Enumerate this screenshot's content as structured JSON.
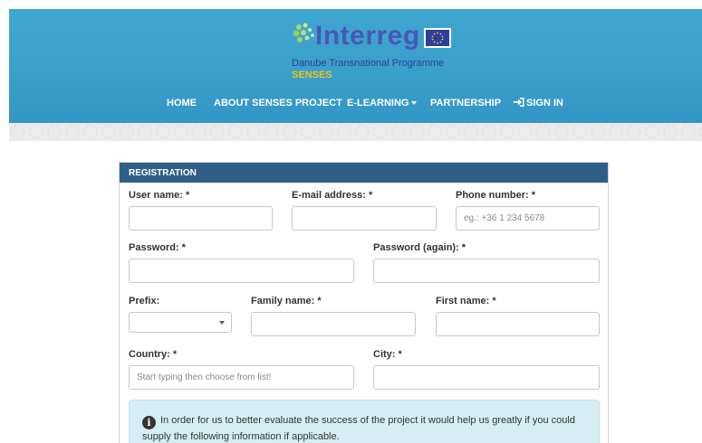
{
  "header": {
    "logo_word": "Interreg",
    "logo_subtitle": "Danube Transnational Programme",
    "logo_project": "SENSES",
    "brand_color": "#3a9fcc"
  },
  "nav": {
    "items": [
      {
        "label": "HOME"
      },
      {
        "label": "ABOUT SENSES PROJECT"
      },
      {
        "label": "E-LEARNING",
        "has_dropdown": true
      },
      {
        "label": "PARTNERSHIP"
      },
      {
        "label": "SIGN IN",
        "icon": "sign-in-icon"
      }
    ]
  },
  "registration": {
    "title": "REGISTRATION",
    "header_color": "#2f5f88",
    "fields": {
      "username": {
        "label": "User name: *",
        "value": ""
      },
      "email": {
        "label": "E-mail address: *",
        "value": ""
      },
      "phone": {
        "label": "Phone number: *",
        "placeholder": "eg.: +36 1 234 5678"
      },
      "password": {
        "label": "Password: *",
        "value": ""
      },
      "password_again": {
        "label": "Password (again): *",
        "value": ""
      },
      "prefix": {
        "label": "Prefix:",
        "selected": ""
      },
      "family_name": {
        "label": "Family name: *",
        "value": ""
      },
      "first_name": {
        "label": "First name: *",
        "value": ""
      },
      "country": {
        "label": "Country: *",
        "placeholder": "Start typing then choose from list!"
      },
      "city": {
        "label": "City: *",
        "value": ""
      }
    },
    "info": {
      "icon": "info-icon",
      "text": "In order for us to better evaluate the success of the project it would help us greatly if you could supply the following information if applicable."
    }
  }
}
